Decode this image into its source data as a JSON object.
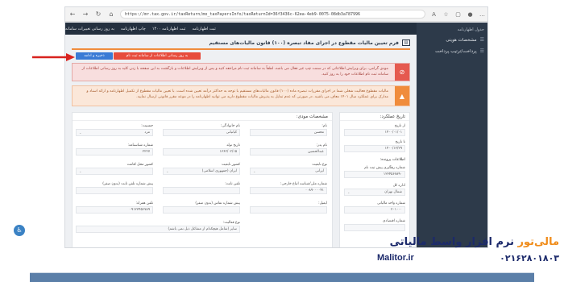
{
  "browser": {
    "url": "https://mr.tax.gov.ir/taxReturn/mo_taxPayersInfo/taxReturnId=36f3436c-62ea-4eb9-0075-08db3a787996",
    "back": "←",
    "forward": "→",
    "reload": "↻",
    "home": "⌂"
  },
  "topbar": {
    "items": [
      "ثبت اظهارنامه",
      "ثبت اظهارنامه ۱۴۰۰",
      "چاپ اظهارنامه",
      "به روز رسانی تغییرات سامانه"
    ]
  },
  "sidebar": {
    "brand": "جدول اظهارنامه",
    "items": [
      {
        "label": "مشخصات هویتی",
        "icon": "☰"
      },
      {
        "label": "پرداخت/ترتیب پرداخت",
        "icon": "☰"
      }
    ]
  },
  "page": {
    "title": "فرم تعیین مالیات مقطوع در اجرای مفاد تبصره (۱۰۰) قانون مالیات‌های مستقیم",
    "save_button": "ذخیره و ادامه",
    "update_button": "به روز رسانی اطلاعات از سامانه ثبت نام"
  },
  "alerts": {
    "red": "مودی گرامی، برای ویرایش اطلاعاتی که در سمت چپ غیر فعال می باشد، لطفاً به سامانه ثبت نام مراجعه کنید و پس از ویرایش اطلاعات و بازگشت به این صفحه با زدن کلید به روز رسانی اطلاعات از سامانه ثبت نام اطلاعات خود را به روز کنید.",
    "orange": "مالیات مقطوع فعالیت شغلی شما در اجرای مقررات تبصره ماده (۱۰۰) قانون مالیات‌های مستقیم با توجه به حداکثر درآمد تعیین شده است. با تعیین مالیات مقطوع از تکمیل اظهارنامه و ارائه اسناد و مدارک برای عملکرد سال ۱۴۰۱ معاف می باشید. در صورتی که عدم تمایل به پذیرش مالیات مقطوع دارید می توانید اظهارنامه را در موعد مقرر قانونی ارسال نمایید."
  },
  "date_panel": {
    "title": "تاریخ عملکرد:",
    "from_label": "از تاریخ",
    "from_value": "۱۴۰۰/۰۱/۰۱",
    "to_label": "تا تاریخ",
    "to_value": "۱۴۰۰/۱۲/۲۹",
    "file_info": "اطلاعات پرونده:",
    "reg_label": "شماره رهگیری پیش ثبت نام",
    "reg_value": "۱۲۳۴۵۶۷۸۹۰",
    "office_label": "اداره کل",
    "office_value": "شمال تهران",
    "unit_label": "شماره واحد مالیاتی",
    "unit_value": "۲۰۱۰۰۰",
    "econ_label": "شماره اقتصادی",
    "econ_value": ""
  },
  "identity": {
    "title": "مشخصات مودی:",
    "name_label": "نام:",
    "name_value": "محسن",
    "family_label": "نام خانوادگی:",
    "family_value": "کیانیانی",
    "gender_label": "جنسیت:",
    "gender_value": "مرد",
    "father_label": "نام پدر:",
    "father_value": "عبدالحسین",
    "birth_label": "تاریخ تولد",
    "birth_value": "۱۳۶۲/۰۲/۱۵",
    "idno_label": "شماره شناسنامه:",
    "idno_value": "۲۲۲۷",
    "nationality_label": "نوع تابعیت",
    "nationality_value": "ایرانی",
    "country_label": "کشور تابعیت",
    "country_value": "ایران (جمهوری اسلامی)",
    "residence_label": "کشور محل اقامت",
    "residence_value": "",
    "nid_label": "شماره ملی/شناسه اتباع خارجی:",
    "nid_value": "۰۰۸۹۰۰۰۰۴۱",
    "phone_label": "تلفن ثابت:",
    "phone_value": "",
    "phone_code_label": "پیش شماره تلفن ثابت (بدون صفر)",
    "phone_code_value": "",
    "email_label": "ایمیل:",
    "email_value": "",
    "mobile_code_label": "پیش شماره تماس (بدون صفر)",
    "mobile_code_value": "",
    "mobile_label": "تلفن همراه:",
    "mobile_value": "۰۹۱۲۳۴۵۶۷۸۹",
    "activity_label": "نوع فعالیت:",
    "activity_placeholder": "سایر (شامل هیچکدام از مشاغل ذیل نمی باشم)"
  },
  "branding": {
    "name_part1": "مالی‌تور",
    "name_part2": " نرم افزار واسط مالیاتی",
    "site": "Malitor.ir",
    "phone": "۰۲۱۶۲۸۰۱۸۰۳"
  }
}
